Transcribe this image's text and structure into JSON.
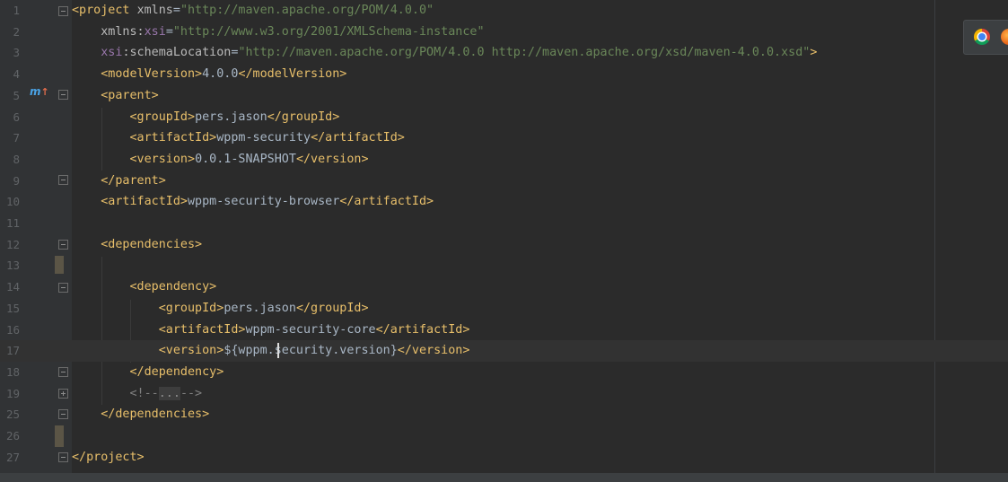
{
  "editor": {
    "lines": [
      {
        "num": "1",
        "segments": [
          [
            "tag",
            "<project "
          ],
          [
            "attr",
            "xmlns"
          ],
          [
            "txt",
            "="
          ],
          [
            "str",
            "\"http://maven.apache.org/POM/4.0.0\""
          ]
        ]
      },
      {
        "num": "2",
        "segments": [
          [
            "txt",
            "    "
          ],
          [
            "attr",
            "xmlns:"
          ],
          [
            "ns",
            "xsi"
          ],
          [
            "txt",
            "="
          ],
          [
            "str",
            "\"http://www.w3.org/2001/XMLSchema-instance\""
          ]
        ]
      },
      {
        "num": "3",
        "segments": [
          [
            "txt",
            "    "
          ],
          [
            "ns",
            "xsi"
          ],
          [
            "attr",
            ":schemaLocation"
          ],
          [
            "txt",
            "="
          ],
          [
            "str",
            "\"http://maven.apache.org/POM/4.0.0 http://maven.apache.org/xsd/maven-4.0.0.xsd\""
          ],
          [
            "tag",
            ">"
          ]
        ]
      },
      {
        "num": "4",
        "segments": [
          [
            "txt",
            "    "
          ],
          [
            "tag",
            "<modelVersion>"
          ],
          [
            "txt",
            "4.0.0"
          ],
          [
            "tag",
            "</modelVersion>"
          ]
        ]
      },
      {
        "num": "5",
        "segments": [
          [
            "txt",
            "    "
          ],
          [
            "tag",
            "<parent>"
          ]
        ]
      },
      {
        "num": "6",
        "segments": [
          [
            "txt",
            "        "
          ],
          [
            "tag",
            "<groupId>"
          ],
          [
            "txt",
            "pers.jason"
          ],
          [
            "tag",
            "</groupId>"
          ]
        ]
      },
      {
        "num": "7",
        "segments": [
          [
            "txt",
            "        "
          ],
          [
            "tag",
            "<artifactId>"
          ],
          [
            "txt",
            "wppm-security"
          ],
          [
            "tag",
            "</artifactId>"
          ]
        ]
      },
      {
        "num": "8",
        "segments": [
          [
            "txt",
            "        "
          ],
          [
            "tag",
            "<version>"
          ],
          [
            "txt",
            "0.0.1-SNAPSHOT"
          ],
          [
            "tag",
            "</version>"
          ]
        ]
      },
      {
        "num": "9",
        "segments": [
          [
            "txt",
            "    "
          ],
          [
            "tag",
            "</parent>"
          ]
        ]
      },
      {
        "num": "10",
        "segments": [
          [
            "txt",
            "    "
          ],
          [
            "tag",
            "<artifactId>"
          ],
          [
            "txt",
            "wppm-security-browser"
          ],
          [
            "tag",
            "</artifactId>"
          ]
        ]
      },
      {
        "num": "11",
        "segments": []
      },
      {
        "num": "12",
        "segments": [
          [
            "txt",
            "    "
          ],
          [
            "tag",
            "<dependencies>"
          ]
        ]
      },
      {
        "num": "13",
        "segments": []
      },
      {
        "num": "14",
        "segments": [
          [
            "txt",
            "        "
          ],
          [
            "tag",
            "<dependency>"
          ]
        ]
      },
      {
        "num": "15",
        "segments": [
          [
            "txt",
            "            "
          ],
          [
            "tag",
            "<groupId>"
          ],
          [
            "txt",
            "pers.jason"
          ],
          [
            "tag",
            "</groupId>"
          ]
        ]
      },
      {
        "num": "16",
        "segments": [
          [
            "txt",
            "            "
          ],
          [
            "tag",
            "<artifactId>"
          ],
          [
            "txt",
            "wppm-security-core"
          ],
          [
            "tag",
            "</artifactId>"
          ]
        ]
      },
      {
        "num": "17",
        "segments": [
          [
            "txt",
            "            "
          ],
          [
            "tag",
            "<version>"
          ],
          [
            "txt",
            "${wppm.security.version}"
          ],
          [
            "tag",
            "</version>"
          ]
        ]
      },
      {
        "num": "18",
        "segments": [
          [
            "txt",
            "        "
          ],
          [
            "tag",
            "</dependency>"
          ]
        ]
      },
      {
        "num": "19",
        "segments": [
          [
            "txt",
            "        "
          ],
          [
            "cmt",
            "<!--"
          ],
          [
            "fold-placeholder",
            "..."
          ],
          [
            "cmt",
            "-->"
          ]
        ]
      },
      {
        "num": "25",
        "segments": [
          [
            "txt",
            "    "
          ],
          [
            "tag",
            "</dependencies>"
          ]
        ]
      },
      {
        "num": "26",
        "segments": []
      },
      {
        "num": "27",
        "segments": [
          [
            "tag",
            "</project>"
          ]
        ]
      }
    ]
  },
  "icons": {
    "maven": "maven-override-icon",
    "chrome": "chrome-icon",
    "firefox": "firefox-icon"
  },
  "colors": {
    "background": "#2b2b2b",
    "tag": "#e8bf6a",
    "string": "#6a8759",
    "namespace": "#9876aa",
    "text": "#a9b7c6"
  }
}
